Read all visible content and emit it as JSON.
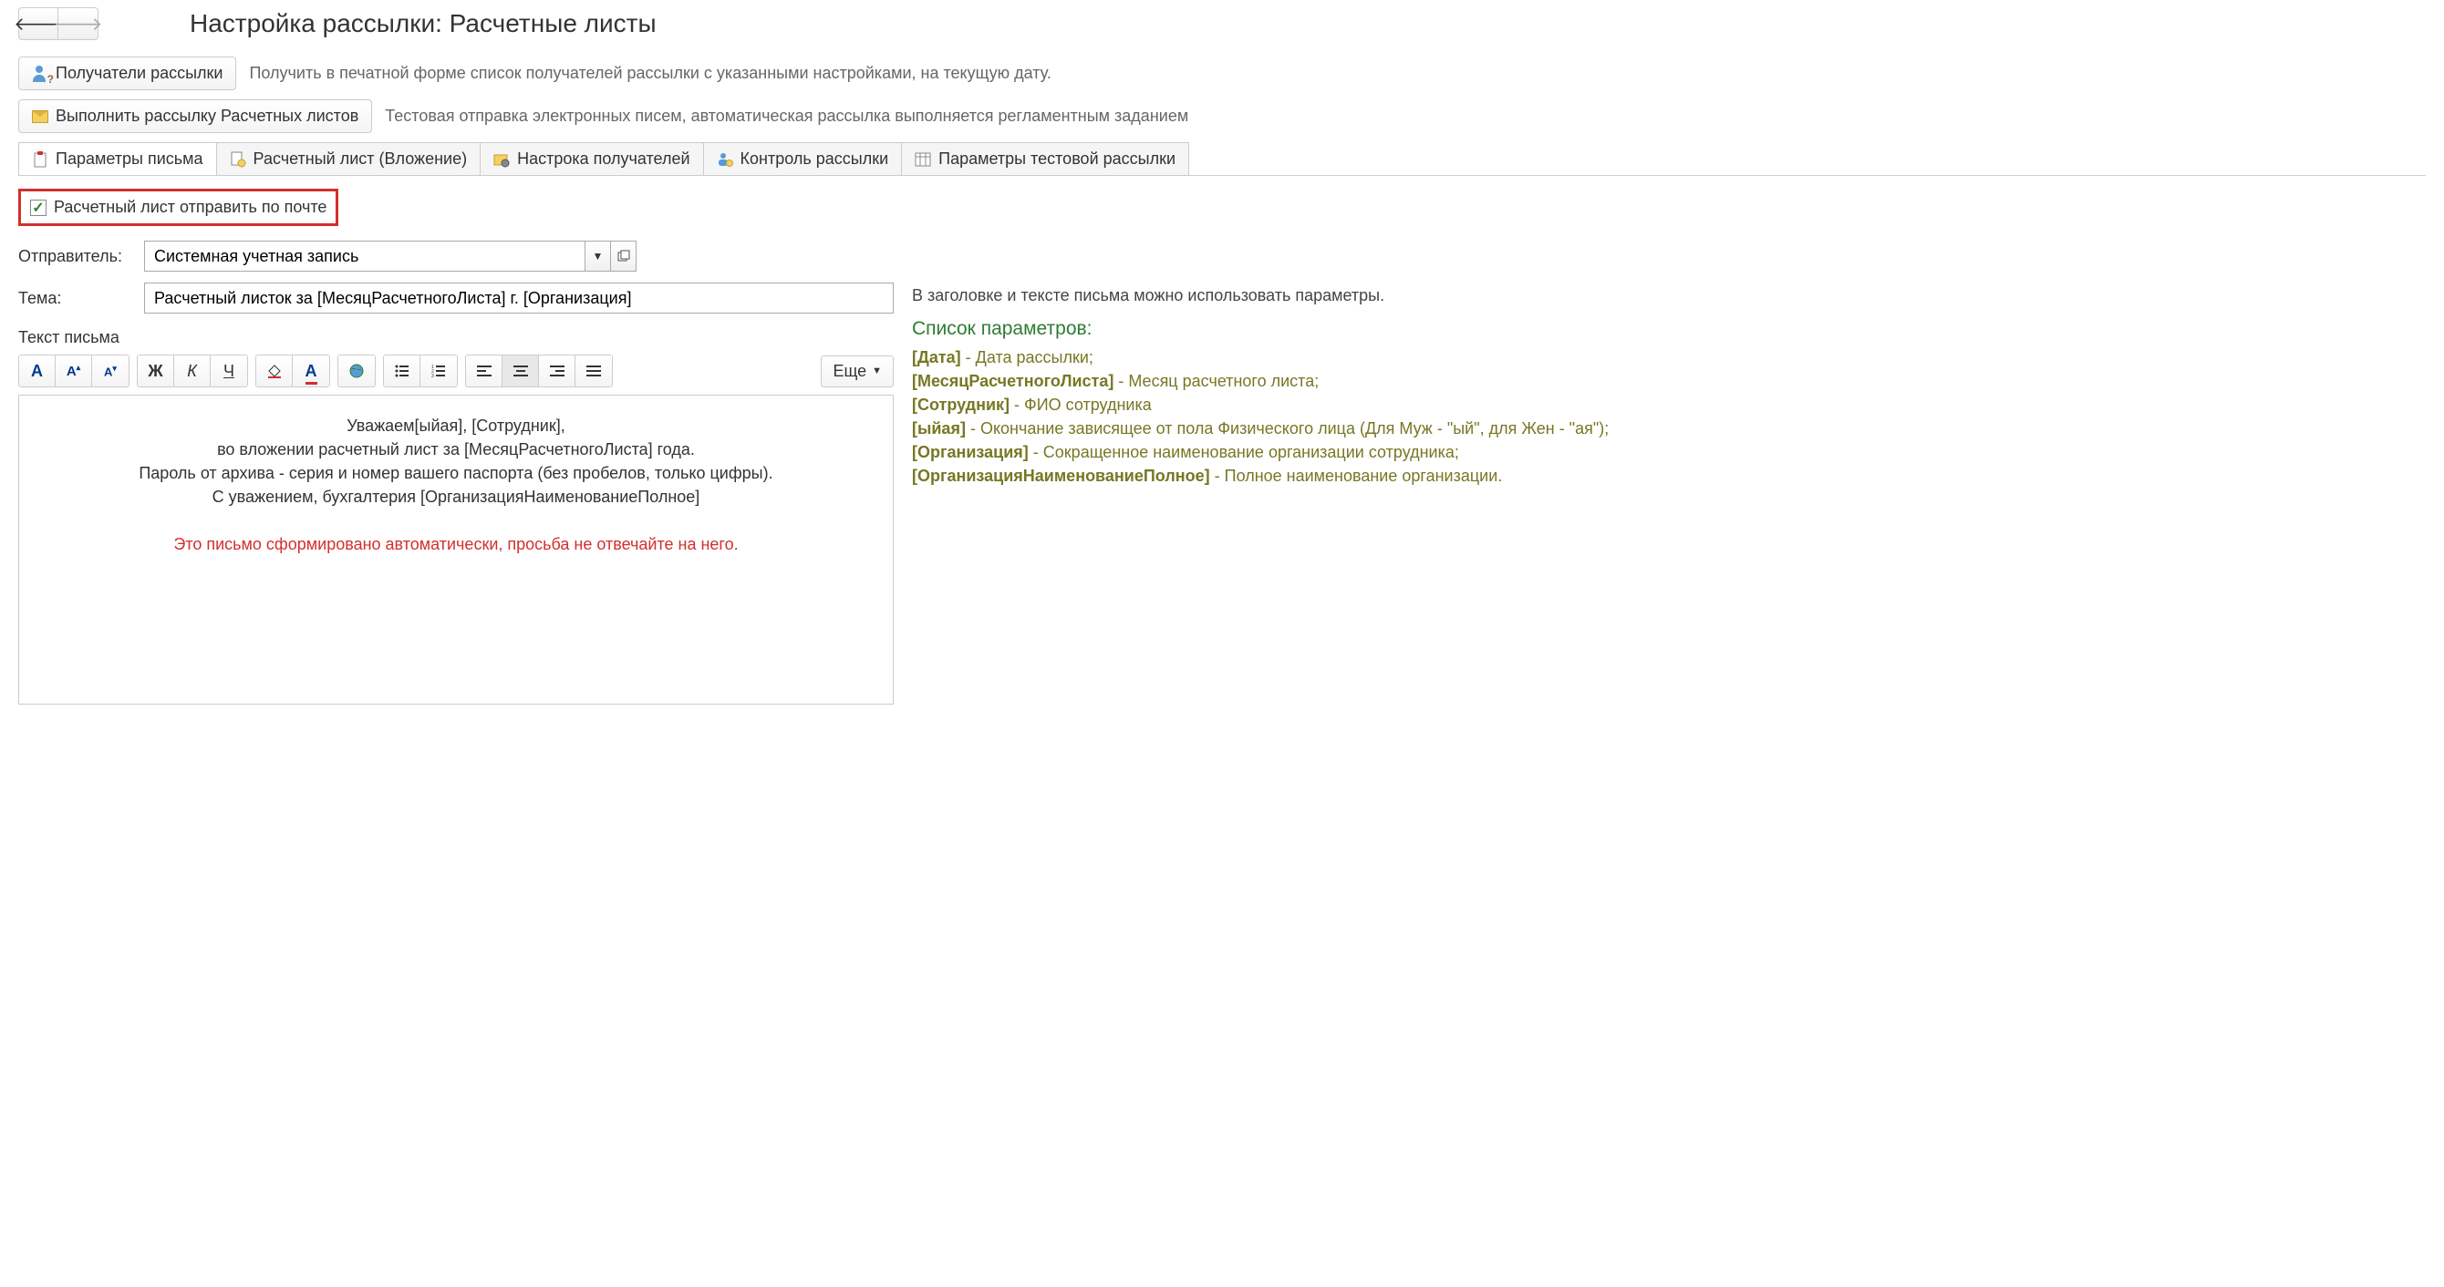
{
  "header": {
    "title": "Настройка рассылки: Расчетные листы"
  },
  "actions": {
    "recipients": {
      "label": "Получатели рассылки",
      "desc": "Получить в печатной форме список получателей рассылки с указанными настройками, на текущую дату."
    },
    "send": {
      "label": "Выполнить рассылку Расчетных листов",
      "desc": "Тестовая отправка электронных писем, автоматическая рассылка выполняется регламентным заданием"
    }
  },
  "tabs": [
    "Параметры письма",
    "Расчетный лист (Вложение)",
    "Настрока получателей",
    "Контроль рассылки",
    "Параметры тестовой рассылки"
  ],
  "checkbox": {
    "label": "Расчетный лист отправить по почте",
    "checked": true
  },
  "sender": {
    "label": "Отправитель:",
    "value": "Системная учетная запись"
  },
  "subject": {
    "label": "Тема:",
    "value": "Расчетный листок за [МесяцРасчетногоЛиста] г. [Организация]"
  },
  "body_label": "Текст письма",
  "more_label": "Еще",
  "editor": {
    "line1": "Уважаем[ыйая], [Сотрудник],",
    "line2": "во вложении расчетный лист за [МесяцРасчетногоЛиста] года.",
    "line3": "Пароль от архива - серия и номер вашего паспорта (без пробелов, только цифры).",
    "line4": "С уважением, бухгалтерия [ОрганизацияНаименованиеПолное]",
    "line5": "Это письмо сформировано автоматически, просьба не отвечайте на него."
  },
  "hint": "В заголовке и тексте письма можно использовать параметры.",
  "params_title": "Список параметров:",
  "params": [
    {
      "key": "[Дата]",
      "desc": " - Дата рассылки;"
    },
    {
      "key": "[МесяцРасчетногоЛиста]",
      "desc": " - Месяц расчетного листа;"
    },
    {
      "key": "[Сотрудник]",
      "desc": " - ФИО сотрудника"
    },
    {
      "key": "[ыйая]",
      "desc": " - Окончание зависящее от пола Физического лица (Для Муж - \"ый\", для Жен - \"ая\");"
    },
    {
      "key": "[Организация]",
      "desc": " - Сокращенное наименование организации сотрудника;"
    },
    {
      "key": "[ОрганизацияНаименованиеПолное]",
      "desc": " - Полное наименование организации."
    }
  ]
}
